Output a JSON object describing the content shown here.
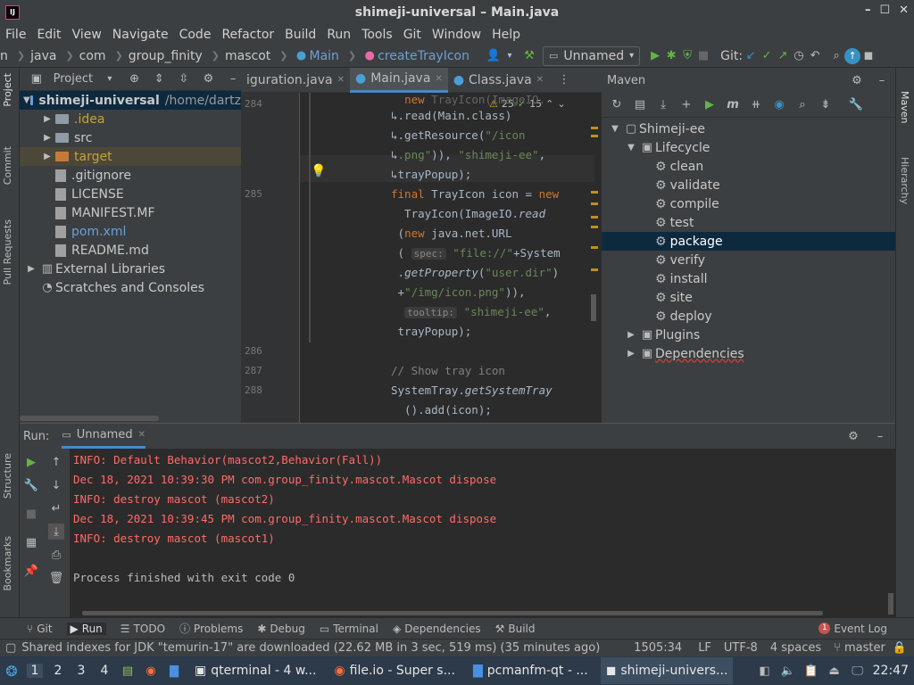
{
  "title": "shimeji-universal – Main.java",
  "menu": [
    "File",
    "Edit",
    "View",
    "Navigate",
    "Code",
    "Refactor",
    "Build",
    "Run",
    "Tools",
    "Git",
    "Window",
    "Help"
  ],
  "breadcrumbs": [
    "n",
    "java",
    "com",
    "group_finity",
    "mascot",
    "Main",
    "createTrayIcon"
  ],
  "run_config": "Unnamed",
  "git_label": "Git:",
  "project": {
    "tab_label": "Project",
    "root_name": "shimeji-universal",
    "root_path": "/home/dartz",
    "items": [
      {
        "name": ".idea",
        "type": "folder",
        "color": "#c8a040"
      },
      {
        "name": "src",
        "type": "folder",
        "color": "#c8c8c8"
      },
      {
        "name": "target",
        "type": "folder",
        "color": "#c8a040"
      },
      {
        "name": ".gitignore",
        "type": "file",
        "color": "#c8c8c8"
      },
      {
        "name": "LICENSE",
        "type": "file",
        "color": "#c8c8c8"
      },
      {
        "name": "MANIFEST.MF",
        "type": "file",
        "color": "#c8c8c8"
      },
      {
        "name": "pom.xml",
        "type": "file",
        "color": "#6a9fd5"
      },
      {
        "name": "README.md",
        "type": "file",
        "color": "#c8c8c8"
      }
    ],
    "external_libraries": "External Libraries",
    "scratches": "Scratches and Consoles"
  },
  "editor_tabs": [
    "iguration.java",
    "Main.java",
    "Class.java"
  ],
  "inspection": {
    "warnings": "25",
    "ok": "15"
  },
  "line_numbers": [
    "284",
    "285",
    "286",
    "287",
    "288"
  ],
  "maven": {
    "title": "Maven",
    "root": "Shimeji-ee",
    "lifecycle": "Lifecycle",
    "goals": [
      "clean",
      "validate",
      "compile",
      "test",
      "package",
      "verify",
      "install",
      "site",
      "deploy"
    ],
    "selected": "package",
    "plugins": "Plugins",
    "dependencies": "Dependencies"
  },
  "run": {
    "label": "Run:",
    "config": "Unnamed",
    "lines": [
      {
        "text": "INFO: Default Behavior(mascot2,Behavior(Fall))",
        "cls": "red"
      },
      {
        "text": "Dec 18, 2021 10:39:30 PM com.group_finity.mascot.Mascot dispose",
        "cls": "red"
      },
      {
        "text": "INFO: destroy mascot (mascot2)",
        "cls": "red"
      },
      {
        "text": "Dec 18, 2021 10:39:45 PM com.group_finity.mascot.Mascot dispose",
        "cls": "red"
      },
      {
        "text": "INFO: destroy mascot (mascot1)",
        "cls": "red"
      },
      {
        "text": "",
        "cls": "plain"
      },
      {
        "text": "Process finished with exit code 0",
        "cls": "plain"
      }
    ]
  },
  "bottom_tabs": [
    "Git",
    "Run",
    "TODO",
    "Problems",
    "Debug",
    "Terminal",
    "Dependencies",
    "Build"
  ],
  "event_log": "Event Log",
  "event_count": "1",
  "status": {
    "message": "Shared indexes for JDK \"temurin-17\" are downloaded (22.62 MB in 3 sec, 519 ms) (35 minutes ago)",
    "position": "1505:34",
    "line_sep": "LF",
    "encoding": "UTF-8",
    "indent": "4 spaces",
    "branch": "master"
  },
  "left_tabs": [
    "Project",
    "Commit",
    "Pull Requests",
    "Structure",
    "Bookmarks"
  ],
  "right_tabs": [
    "Maven",
    "Hierarchy"
  ],
  "taskbar": {
    "workspaces": [
      "1",
      "2",
      "3",
      "4"
    ],
    "tasks": [
      "qterminal - 4 w...",
      "file.io - Super s...",
      "pcmanfm-qt - ...",
      "shimeji-univers..."
    ],
    "clock": "22:47"
  }
}
